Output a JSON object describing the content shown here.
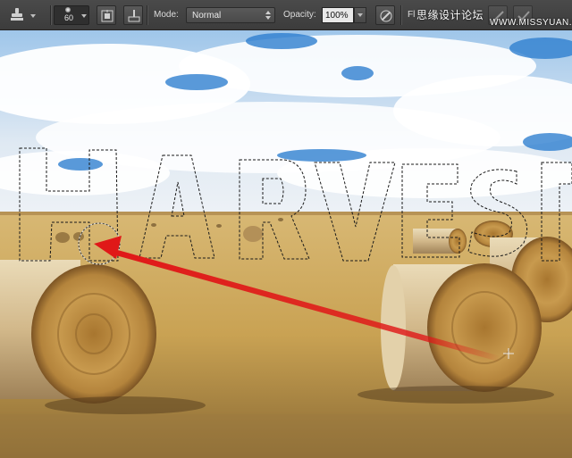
{
  "options_bar": {
    "tool_preset_icon": "clone-stamp-icon",
    "brush_size": "60",
    "toggle_clone_source_icon": "clone-source-panel-icon",
    "toggle_brush_panel_icon": "brush-panel-icon",
    "mode_label": "Mode:",
    "mode_value": "Normal",
    "opacity_label": "Opacity:",
    "opacity_value": "100%",
    "pressure_opacity_icon": "pressure-opacity-icon",
    "flow_label": "Fl",
    "watermark_cn": "思缘设计论坛",
    "watermark_en": "WWW.MISSYUAN.COM"
  },
  "canvas": {
    "selection_text": "HARVEST",
    "clone_source_icon": "crosshair-icon",
    "annotation_arrow": "red-arrow"
  },
  "colors": {
    "toolbar_bg": "#3f3f3f",
    "sky_blue": "#2f7fd0",
    "field_gold": "#c9a253",
    "arrow_red": "#e01818"
  }
}
